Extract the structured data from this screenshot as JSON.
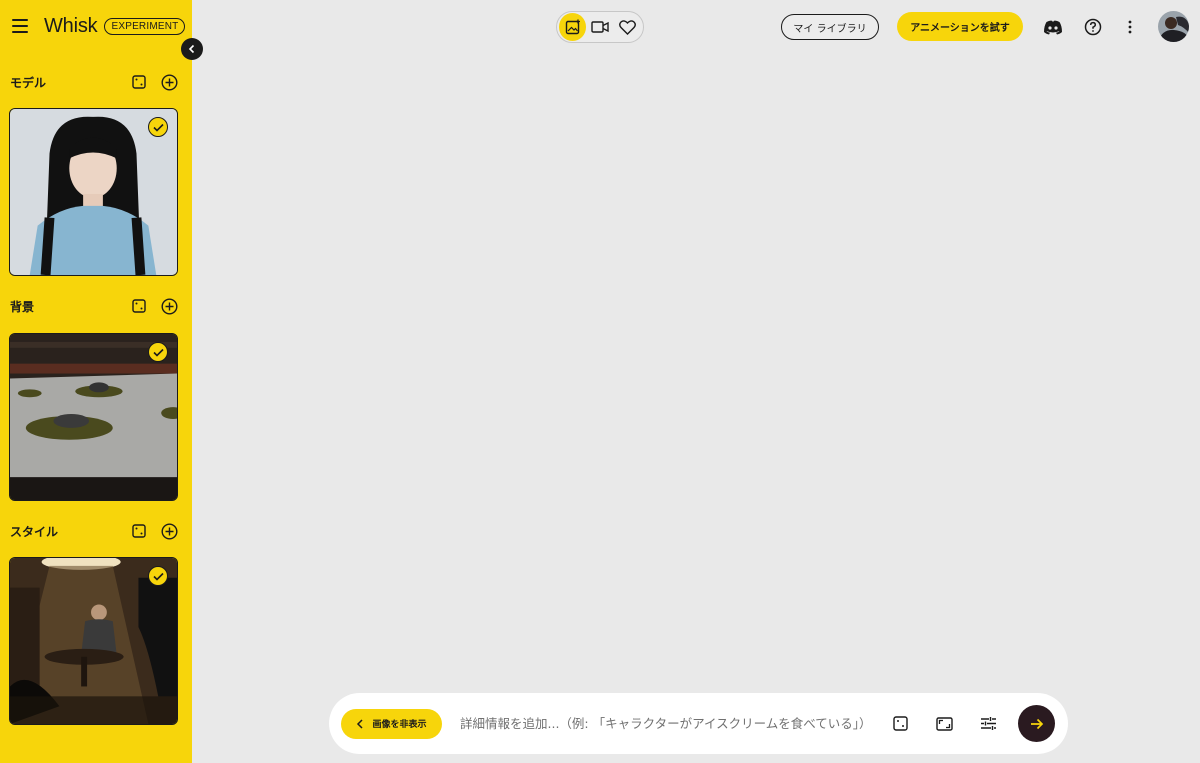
{
  "app": {
    "title": "Whisk",
    "badge": "EXPERIMENT"
  },
  "sidebar": {
    "sections": [
      {
        "title": "モデル",
        "image": "woman-portrait",
        "selected": true
      },
      {
        "title": "背景",
        "image": "zen-rock-garden",
        "selected": true
      },
      {
        "title": "スタイル",
        "image": "dim-room-man-at-table",
        "selected": true
      }
    ]
  },
  "header": {
    "modes": [
      "image-mode-icon",
      "video-mode-icon",
      "favorites-heart-icon"
    ],
    "library_label": "マイ ライブラリ",
    "animate_label": "アニメーションを試す"
  },
  "prompt": {
    "hide_images_label": "画像を非表示",
    "placeholder": "詳細情報を追加...（例: 「キャラクターがアイスクリームを食べている」）"
  },
  "colors": {
    "accent": "#f7d50b",
    "background": "#e9e9e9",
    "dark": "#1b1b1b",
    "send": "#2a1a20"
  }
}
